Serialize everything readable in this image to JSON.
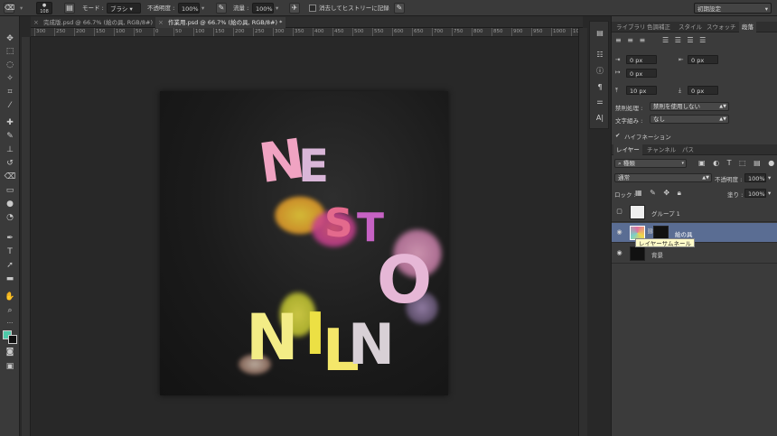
{
  "options_bar": {
    "brush_size": "108",
    "mode_label": "モード :",
    "mode_value": "ブラシ",
    "opacity_label": "不透明度 :",
    "opacity_value": "100%",
    "flow_label": "流量 :",
    "flow_value": "100%",
    "erase_history_label": "消去してヒストリーに記録",
    "workspace_value": "初期設定"
  },
  "doc_tabs": [
    {
      "label": "完成版.psd @ 66.7% (絵の具, RGB/8#)",
      "active": false
    },
    {
      "label": "作業用.psd @ 66.7% (絵の具, RGB/8#) *",
      "active": true
    }
  ],
  "ruler_ticks": [
    "300",
    "250",
    "200",
    "150",
    "100",
    "50",
    "0",
    "50",
    "100",
    "150",
    "200",
    "250",
    "300",
    "350",
    "400",
    "450",
    "500",
    "550",
    "600",
    "650",
    "700",
    "750",
    "800",
    "850",
    "900",
    "950",
    "1000",
    "1050",
    "1100"
  ],
  "artwork": {
    "row1": [
      "N",
      "E",
      "S",
      "T",
      "O"
    ],
    "row2": [
      "N",
      "I",
      "L",
      "N"
    ]
  },
  "panel_top": {
    "tabs": [
      "ライブラリ",
      "色調補正",
      "スタイル",
      "スウォッチ",
      "段落"
    ],
    "active_tab": "段落",
    "indent_left": "0 px",
    "indent_right": "0 px",
    "indent_first": "0 px",
    "space_before": "10 px",
    "space_after": "0 px",
    "kinsoku_label": "禁則処理 :",
    "kinsoku_value": "禁則を使用しない",
    "mojikumi_label": "文字組み :",
    "mojikumi_value": "なし",
    "hyphenation_label": "ハイフネーション"
  },
  "layers_panel": {
    "tabs": [
      "レイヤー",
      "チャンネル",
      "パス"
    ],
    "active_tab": "レイヤー",
    "filter_kind": "種類",
    "blend_mode": "通常",
    "opacity_label": "不透明度 :",
    "opacity_value": "100%",
    "lock_label": "ロック :",
    "fill_label": "塗り :",
    "fill_value": "100%",
    "layers": [
      {
        "name": "グループ 1",
        "visible": false,
        "selected": false
      },
      {
        "name": "絵の具",
        "visible": true,
        "selected": true
      },
      {
        "name": "背景",
        "visible": true,
        "selected": false
      }
    ],
    "tooltip": "レイヤーサムネール"
  },
  "colors": {
    "foreground": "#4ec9a8",
    "background": "#111111",
    "selection": "#5a6d93"
  }
}
